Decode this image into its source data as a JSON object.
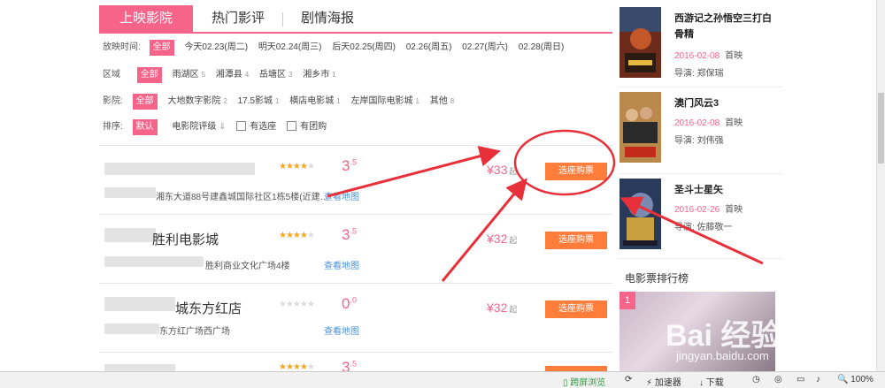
{
  "tabs": [
    "上映影院",
    "热门影评",
    "剧情海报"
  ],
  "filters": {
    "time_label": "放映时间:",
    "time_options": [
      "全部",
      "今天02.23(周二)",
      "明天02.24(周三)",
      "后天02.25(周四)",
      "02.26(周五)",
      "02.27(周六)",
      "02.28(周日)"
    ],
    "area_label": "区域",
    "area_options": [
      {
        "name": "全部",
        "count": ""
      },
      {
        "name": "雨湖区",
        "count": "5"
      },
      {
        "name": "湘潭县",
        "count": "4"
      },
      {
        "name": "岳塘区",
        "count": "3"
      },
      {
        "name": "湘乡市",
        "count": "1"
      }
    ],
    "cinema_label": "影院:",
    "cinema_options": [
      {
        "name": "全部",
        "count": ""
      },
      {
        "name": "大地数字影院",
        "count": "2"
      },
      {
        "name": "17.5影城",
        "count": "1"
      },
      {
        "name": "横店电影城",
        "count": "1"
      },
      {
        "name": "左岸国际电影城",
        "count": "1"
      },
      {
        "name": "其他",
        "count": "8"
      }
    ],
    "sort_label": "排序:",
    "sort_default": "默认",
    "sort_rating": "电影院评级",
    "sort_rating_arrow": "⇓",
    "has_seat": "有选座",
    "has_group": "有团购"
  },
  "cinemas": [
    {
      "name": "",
      "stars": 3.5,
      "score": "3",
      "score_dec": ".5",
      "address": "湘东大道88号建鑫城国际社区1栋5楼(近建…",
      "map": "查看地图",
      "price": "¥33",
      "price_suffix": "起",
      "buy": "选座购票"
    },
    {
      "name": "胜利电影城",
      "stars": 3.5,
      "score": "3",
      "score_dec": ".5",
      "address": "胜利商业文化广场4楼",
      "map": "查看地图",
      "price": "¥32",
      "price_suffix": "起",
      "buy": "选座购票"
    },
    {
      "name": "城东方红店",
      "stars": 0,
      "score": "0",
      "score_dec": ".0",
      "address": "东方红广场西广场",
      "map": "查看地图",
      "price": "¥32",
      "price_suffix": "起",
      "buy": "选座购票"
    },
    {
      "name": "",
      "stars": 3.5,
      "score": "3",
      "score_dec": ".5",
      "address": "",
      "map": "",
      "price": "",
      "price_suffix": "",
      "buy": ""
    }
  ],
  "movies": [
    {
      "title": "西游记之孙悟空三打白骨精",
      "date": "2016-02-08",
      "status": "首映",
      "director_label": "导演:",
      "director": "郑保瑞"
    },
    {
      "title": "澳门风云3",
      "date": "2016-02-08",
      "status": "首映",
      "director_label": "导演:",
      "director": "刘伟强"
    },
    {
      "title": "圣斗士星矢",
      "date": "2016-02-26",
      "status": "首映",
      "director_label": "导演:",
      "director": "佐藤敬一"
    }
  ],
  "ranking": {
    "title": "电影票排行榜",
    "badge": "1"
  },
  "watermark": {
    "logo": "Bai 经验",
    "url": "jingyan.baidu.com"
  },
  "statusbar": {
    "cross_screen": "跨屏浏览",
    "accelerator": "加速器",
    "download": "下载",
    "zoom": "100%"
  },
  "colors": {
    "accent": "#f7648a",
    "buy": "#ff7d3a",
    "arrow": "#e8303a"
  }
}
